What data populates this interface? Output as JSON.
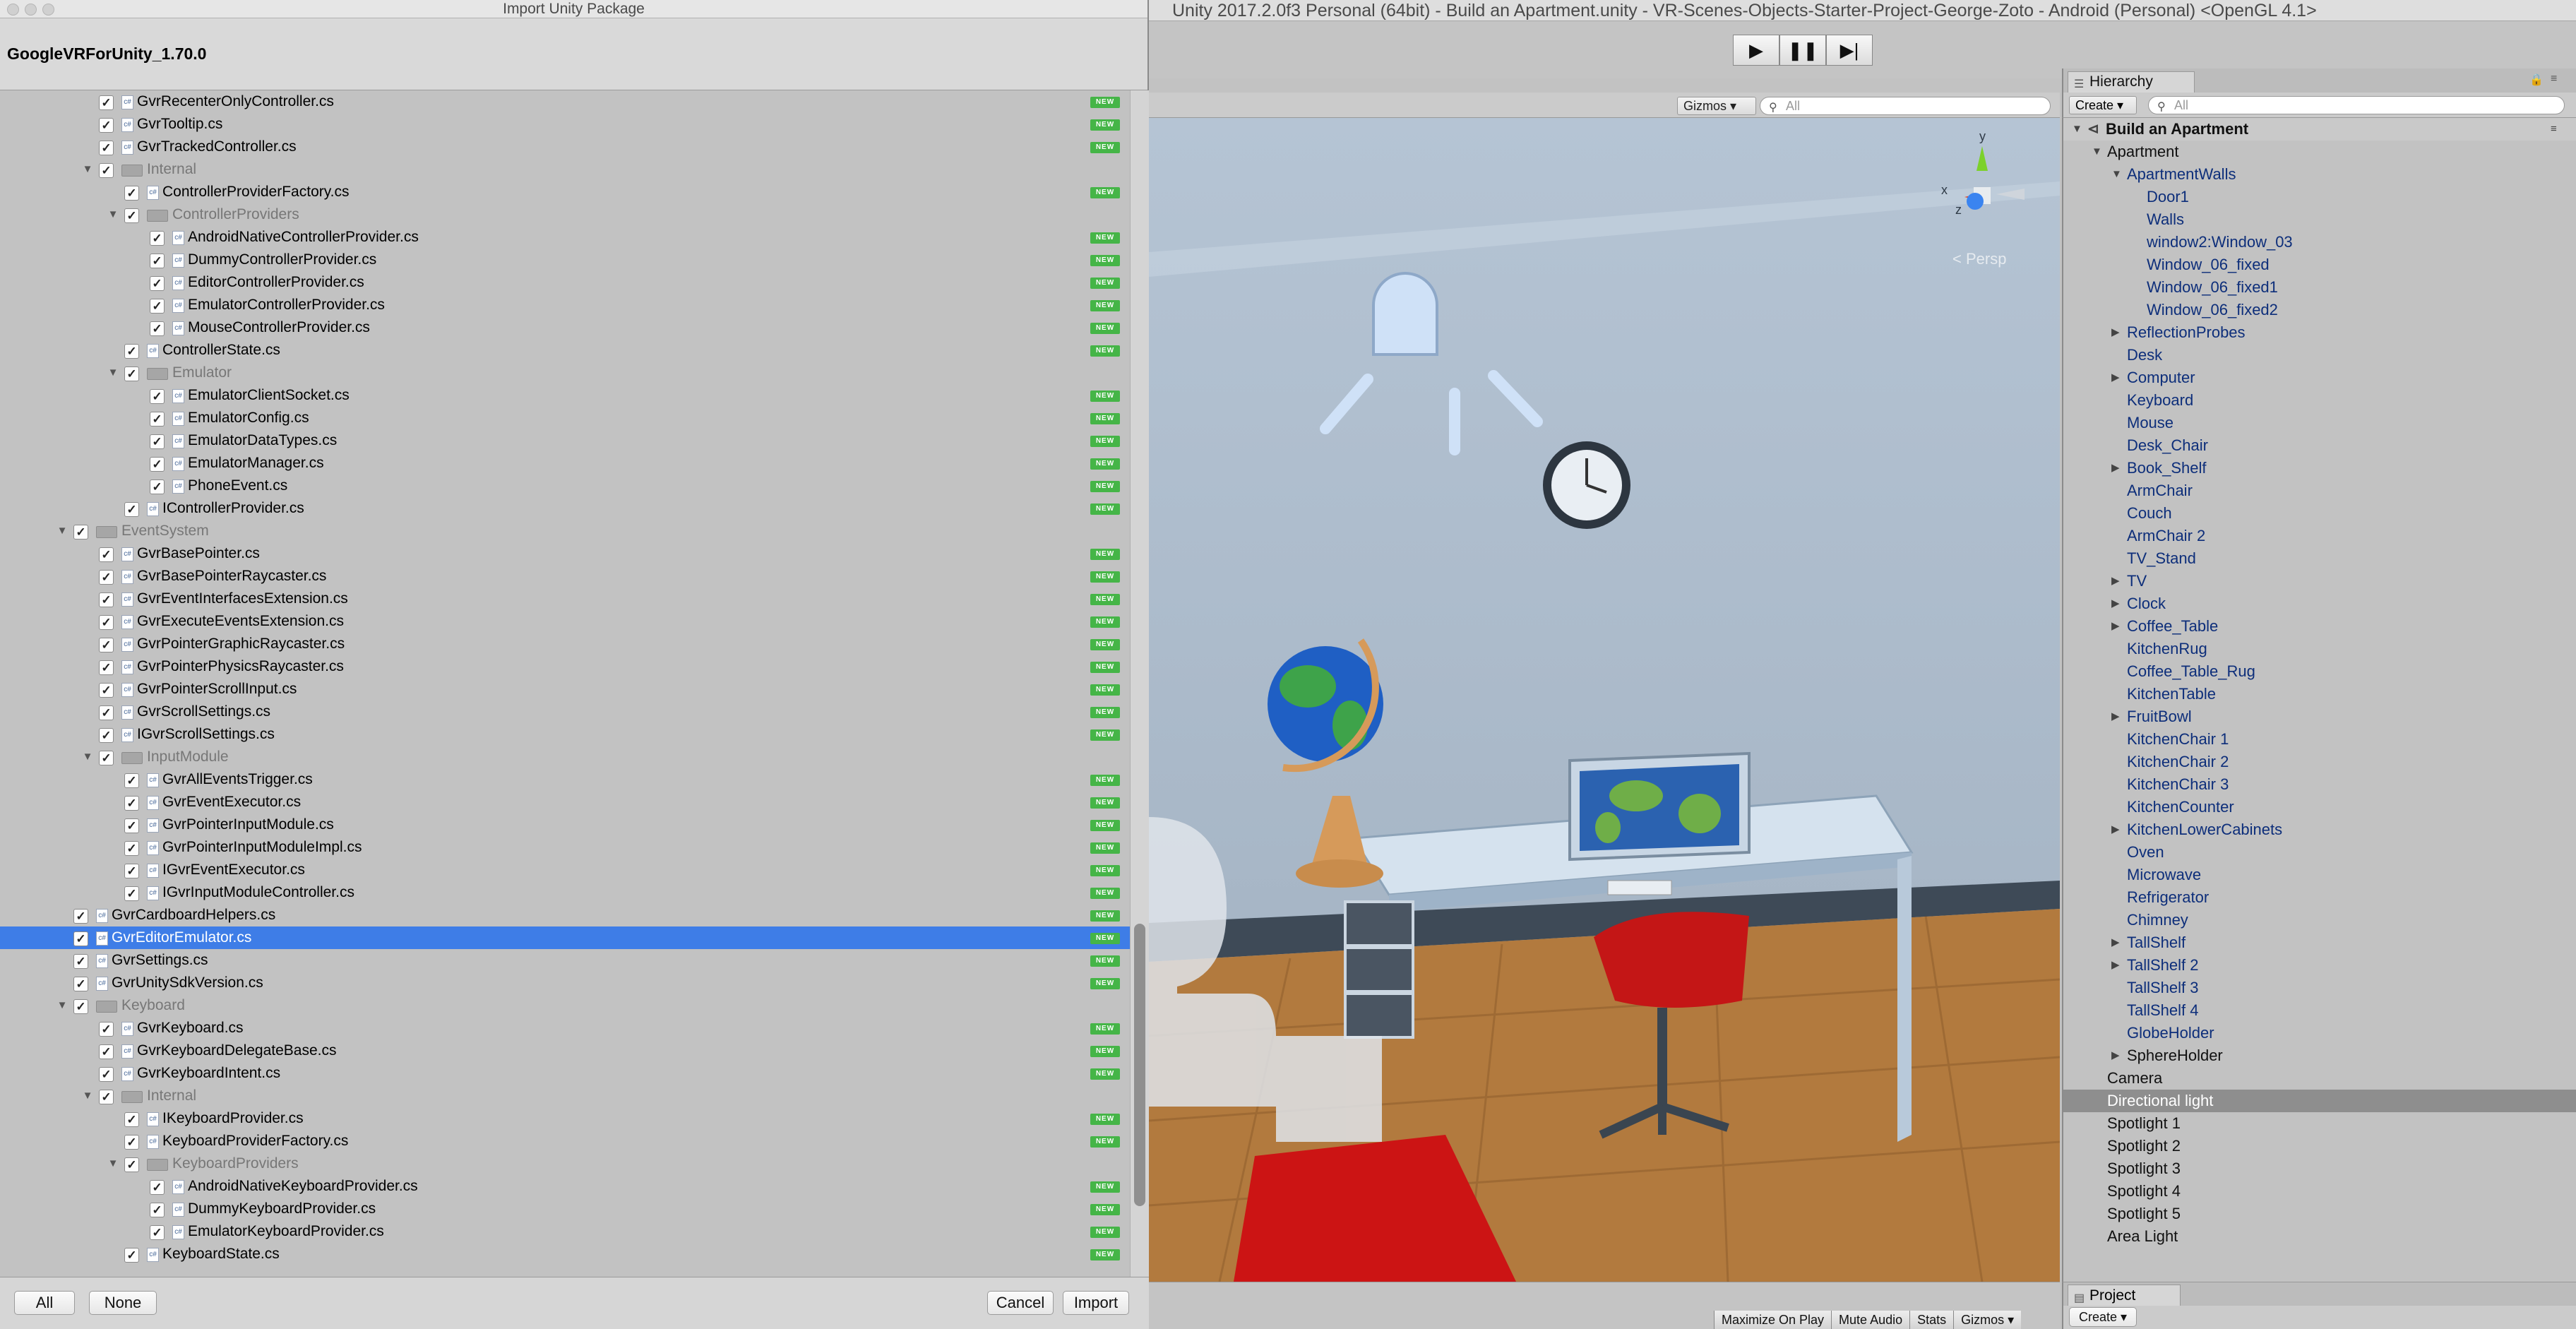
{
  "dialog": {
    "title": "Import Unity Package",
    "package_name": "GoogleVRForUnity_1.70.0",
    "new_badge": "NEW",
    "buttons": {
      "all": "All",
      "none": "None",
      "cancel": "Cancel",
      "import": "Import"
    },
    "items": [
      {
        "label": "GvrRecenterOnlyController.cs",
        "depth": 3,
        "kind": "file",
        "new": true
      },
      {
        "label": "GvrTooltip.cs",
        "depth": 3,
        "kind": "file",
        "new": true
      },
      {
        "label": "GvrTrackedController.cs",
        "depth": 3,
        "kind": "file",
        "new": true
      },
      {
        "label": "Internal",
        "depth": 3,
        "kind": "folder",
        "new": false
      },
      {
        "label": "ControllerProviderFactory.cs",
        "depth": 4,
        "kind": "file",
        "new": true
      },
      {
        "label": "ControllerProviders",
        "depth": 4,
        "kind": "folder",
        "new": false
      },
      {
        "label": "AndroidNativeControllerProvider.cs",
        "depth": 5,
        "kind": "file",
        "new": true
      },
      {
        "label": "DummyControllerProvider.cs",
        "depth": 5,
        "kind": "file",
        "new": true
      },
      {
        "label": "EditorControllerProvider.cs",
        "depth": 5,
        "kind": "file",
        "new": true
      },
      {
        "label": "EmulatorControllerProvider.cs",
        "depth": 5,
        "kind": "file",
        "new": true
      },
      {
        "label": "MouseControllerProvider.cs",
        "depth": 5,
        "kind": "file",
        "new": true
      },
      {
        "label": "ControllerState.cs",
        "depth": 4,
        "kind": "file",
        "new": true
      },
      {
        "label": "Emulator",
        "depth": 4,
        "kind": "folder",
        "new": false
      },
      {
        "label": "EmulatorClientSocket.cs",
        "depth": 5,
        "kind": "file",
        "new": true
      },
      {
        "label": "EmulatorConfig.cs",
        "depth": 5,
        "kind": "file",
        "new": true
      },
      {
        "label": "EmulatorDataTypes.cs",
        "depth": 5,
        "kind": "file",
        "new": true
      },
      {
        "label": "EmulatorManager.cs",
        "depth": 5,
        "kind": "file",
        "new": true
      },
      {
        "label": "PhoneEvent.cs",
        "depth": 5,
        "kind": "file",
        "new": true
      },
      {
        "label": "IControllerProvider.cs",
        "depth": 4,
        "kind": "file",
        "new": true
      },
      {
        "label": "EventSystem",
        "depth": 2,
        "kind": "folder",
        "new": false
      },
      {
        "label": "GvrBasePointer.cs",
        "depth": 3,
        "kind": "file",
        "new": true
      },
      {
        "label": "GvrBasePointerRaycaster.cs",
        "depth": 3,
        "kind": "file",
        "new": true
      },
      {
        "label": "GvrEventInterfacesExtension.cs",
        "depth": 3,
        "kind": "file",
        "new": true
      },
      {
        "label": "GvrExecuteEventsExtension.cs",
        "depth": 3,
        "kind": "file",
        "new": true
      },
      {
        "label": "GvrPointerGraphicRaycaster.cs",
        "depth": 3,
        "kind": "file",
        "new": true
      },
      {
        "label": "GvrPointerPhysicsRaycaster.cs",
        "depth": 3,
        "kind": "file",
        "new": true
      },
      {
        "label": "GvrPointerScrollInput.cs",
        "depth": 3,
        "kind": "file",
        "new": true
      },
      {
        "label": "GvrScrollSettings.cs",
        "depth": 3,
        "kind": "file",
        "new": true
      },
      {
        "label": "IGvrScrollSettings.cs",
        "depth": 3,
        "kind": "file",
        "new": true
      },
      {
        "label": "InputModule",
        "depth": 3,
        "kind": "folder",
        "new": false
      },
      {
        "label": "GvrAllEventsTrigger.cs",
        "depth": 4,
        "kind": "file",
        "new": true
      },
      {
        "label": "GvrEventExecutor.cs",
        "depth": 4,
        "kind": "file",
        "new": true
      },
      {
        "label": "GvrPointerInputModule.cs",
        "depth": 4,
        "kind": "file",
        "new": true
      },
      {
        "label": "GvrPointerInputModuleImpl.cs",
        "depth": 4,
        "kind": "file",
        "new": true
      },
      {
        "label": "IGvrEventExecutor.cs",
        "depth": 4,
        "kind": "file",
        "new": true
      },
      {
        "label": "IGvrInputModuleController.cs",
        "depth": 4,
        "kind": "file",
        "new": true
      },
      {
        "label": "GvrCardboardHelpers.cs",
        "depth": 2,
        "kind": "file",
        "new": true
      },
      {
        "label": "GvrEditorEmulator.cs",
        "depth": 2,
        "kind": "file",
        "new": true,
        "selected": true
      },
      {
        "label": "GvrSettings.cs",
        "depth": 2,
        "kind": "file",
        "new": true
      },
      {
        "label": "GvrUnitySdkVersion.cs",
        "depth": 2,
        "kind": "file",
        "new": true
      },
      {
        "label": "Keyboard",
        "depth": 2,
        "kind": "folder",
        "new": false
      },
      {
        "label": "GvrKeyboard.cs",
        "depth": 3,
        "kind": "file",
        "new": true
      },
      {
        "label": "GvrKeyboardDelegateBase.cs",
        "depth": 3,
        "kind": "file",
        "new": true
      },
      {
        "label": "GvrKeyboardIntent.cs",
        "depth": 3,
        "kind": "file",
        "new": true
      },
      {
        "label": "Internal",
        "depth": 3,
        "kind": "folder",
        "new": false
      },
      {
        "label": "IKeyboardProvider.cs",
        "depth": 4,
        "kind": "file",
        "new": true
      },
      {
        "label": "KeyboardProviderFactory.cs",
        "depth": 4,
        "kind": "file",
        "new": true
      },
      {
        "label": "KeyboardProviders",
        "depth": 4,
        "kind": "folder",
        "new": false
      },
      {
        "label": "AndroidNativeKeyboardProvider.cs",
        "depth": 5,
        "kind": "file",
        "new": true
      },
      {
        "label": "DummyKeyboardProvider.cs",
        "depth": 5,
        "kind": "file",
        "new": true
      },
      {
        "label": "EmulatorKeyboardProvider.cs",
        "depth": 5,
        "kind": "file",
        "new": true
      },
      {
        "label": "KeyboardState.cs",
        "depth": 4,
        "kind": "file",
        "new": true
      }
    ]
  },
  "window": {
    "title": "Unity 2017.2.0f3 Personal (64bit) - Build an Apartment.unity - VR-Scenes-Objects-Starter-Project-George-Zoto - Android (Personal) <OpenGL 4.1>"
  },
  "toolbar": {
    "play_icon": "▶",
    "pause_icon": "❚❚",
    "step_icon": "▶|"
  },
  "scene": {
    "gizmos_label": "Gizmos ▾",
    "search_placeholder": "All",
    "persp_label": "< Persp",
    "axis_y": "y",
    "axis_x": "x",
    "axis_z": "z"
  },
  "game_bar": {
    "maximize_on_play": "Maximize On Play",
    "mute_audio": "Mute Audio",
    "stats": "Stats",
    "gizmos": "Gizmos ▾"
  },
  "hierarchy": {
    "tab_label": "Hierarchy",
    "create_label": "Create ▾",
    "search_placeholder": "All",
    "items": [
      {
        "label": "Build an Apartment",
        "depth": 0,
        "kind": "scene",
        "arrow": "open"
      },
      {
        "label": "Apartment",
        "depth": 1,
        "kind": "plain",
        "arrow": "open"
      },
      {
        "label": "ApartmentWalls",
        "depth": 2,
        "kind": "prefab",
        "arrow": "open"
      },
      {
        "label": "Door1",
        "depth": 3,
        "kind": "prefab",
        "arrow": "none"
      },
      {
        "label": "Walls",
        "depth": 3,
        "kind": "prefab",
        "arrow": "none"
      },
      {
        "label": "window2:Window_03",
        "depth": 3,
        "kind": "prefab",
        "arrow": "none"
      },
      {
        "label": "Window_06_fixed",
        "depth": 3,
        "kind": "prefab",
        "arrow": "none"
      },
      {
        "label": "Window_06_fixed1",
        "depth": 3,
        "kind": "prefab",
        "arrow": "none"
      },
      {
        "label": "Window_06_fixed2",
        "depth": 3,
        "kind": "prefab",
        "arrow": "none"
      },
      {
        "label": "ReflectionProbes",
        "depth": 2,
        "kind": "prefab",
        "arrow": "closed"
      },
      {
        "label": "Desk",
        "depth": 2,
        "kind": "prefab",
        "arrow": "none"
      },
      {
        "label": "Computer",
        "depth": 2,
        "kind": "prefab",
        "arrow": "closed"
      },
      {
        "label": "Keyboard",
        "depth": 2,
        "kind": "prefab",
        "arrow": "none"
      },
      {
        "label": "Mouse",
        "depth": 2,
        "kind": "prefab",
        "arrow": "none"
      },
      {
        "label": "Desk_Chair",
        "depth": 2,
        "kind": "prefab",
        "arrow": "none"
      },
      {
        "label": "Book_Shelf",
        "depth": 2,
        "kind": "prefab",
        "arrow": "closed"
      },
      {
        "label": "ArmChair",
        "depth": 2,
        "kind": "prefab",
        "arrow": "none"
      },
      {
        "label": "Couch",
        "depth": 2,
        "kind": "prefab",
        "arrow": "none"
      },
      {
        "label": "ArmChair 2",
        "depth": 2,
        "kind": "prefab",
        "arrow": "none"
      },
      {
        "label": "TV_Stand",
        "depth": 2,
        "kind": "prefab",
        "arrow": "none"
      },
      {
        "label": "TV",
        "depth": 2,
        "kind": "prefab",
        "arrow": "closed"
      },
      {
        "label": "Clock",
        "depth": 2,
        "kind": "prefab",
        "arrow": "closed"
      },
      {
        "label": "Coffee_Table",
        "depth": 2,
        "kind": "prefab",
        "arrow": "closed"
      },
      {
        "label": "KitchenRug",
        "depth": 2,
        "kind": "prefab",
        "arrow": "none"
      },
      {
        "label": "Coffee_Table_Rug",
        "depth": 2,
        "kind": "prefab",
        "arrow": "none"
      },
      {
        "label": "KitchenTable",
        "depth": 2,
        "kind": "prefab",
        "arrow": "none"
      },
      {
        "label": "FruitBowl",
        "depth": 2,
        "kind": "prefab",
        "arrow": "closed"
      },
      {
        "label": "KitchenChair 1",
        "depth": 2,
        "kind": "prefab",
        "arrow": "none"
      },
      {
        "label": "KitchenChair 2",
        "depth": 2,
        "kind": "prefab",
        "arrow": "none"
      },
      {
        "label": "KitchenChair 3",
        "depth": 2,
        "kind": "prefab",
        "arrow": "none"
      },
      {
        "label": "KitchenCounter",
        "depth": 2,
        "kind": "prefab",
        "arrow": "none"
      },
      {
        "label": "KitchenLowerCabinets",
        "depth": 2,
        "kind": "prefab",
        "arrow": "closed"
      },
      {
        "label": "Oven",
        "depth": 2,
        "kind": "prefab",
        "arrow": "none"
      },
      {
        "label": "Microwave",
        "depth": 2,
        "kind": "prefab",
        "arrow": "none"
      },
      {
        "label": "Refrigerator",
        "depth": 2,
        "kind": "prefab",
        "arrow": "none"
      },
      {
        "label": "Chimney",
        "depth": 2,
        "kind": "prefab",
        "arrow": "none"
      },
      {
        "label": "TallShelf",
        "depth": 2,
        "kind": "prefab",
        "arrow": "closed"
      },
      {
        "label": "TallShelf 2",
        "depth": 2,
        "kind": "prefab",
        "arrow": "closed"
      },
      {
        "label": "TallShelf 3",
        "depth": 2,
        "kind": "prefab",
        "arrow": "none"
      },
      {
        "label": "TallShelf 4",
        "depth": 2,
        "kind": "prefab",
        "arrow": "none"
      },
      {
        "label": "GlobeHolder",
        "depth": 2,
        "kind": "prefab",
        "arrow": "none"
      },
      {
        "label": "SphereHolder",
        "depth": 2,
        "kind": "plain",
        "arrow": "closed"
      },
      {
        "label": "Camera",
        "depth": 1,
        "kind": "plain",
        "arrow": "none"
      },
      {
        "label": "Directional light",
        "depth": 1,
        "kind": "plain",
        "arrow": "none",
        "selected": true
      },
      {
        "label": "Spotlight 1",
        "depth": 1,
        "kind": "plain",
        "arrow": "none"
      },
      {
        "label": "Spotlight 2",
        "depth": 1,
        "kind": "plain",
        "arrow": "none"
      },
      {
        "label": "Spotlight 3",
        "depth": 1,
        "kind": "plain",
        "arrow": "none"
      },
      {
        "label": "Spotlight 4",
        "depth": 1,
        "kind": "plain",
        "arrow": "none"
      },
      {
        "label": "Spotlight 5",
        "depth": 1,
        "kind": "plain",
        "arrow": "none"
      },
      {
        "label": "Area Light",
        "depth": 1,
        "kind": "plain",
        "arrow": "none"
      }
    ]
  },
  "project": {
    "tab_label": "Project",
    "create_label": "Create ▾"
  },
  "colors": {
    "selection": "#3e7de7",
    "new_badge": "#45b547",
    "prefab_text": "#0d2e7a",
    "hier_selection": "#8e8e8e"
  }
}
